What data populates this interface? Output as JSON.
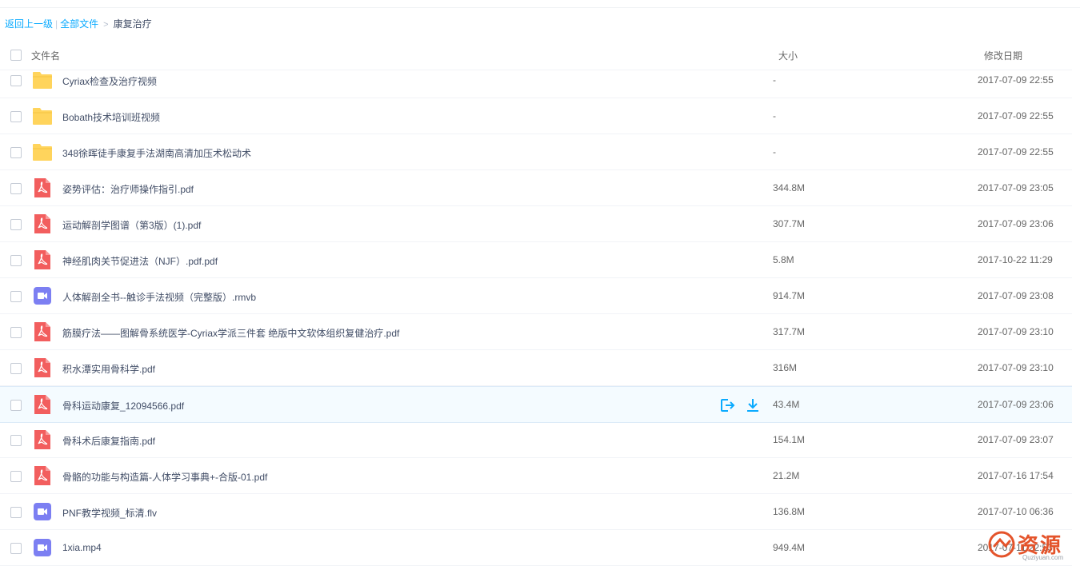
{
  "breadcrumb": {
    "back": "返回上一级",
    "separator": "|",
    "all_files": "全部文件",
    "arrow": ">",
    "current": "康复治疗"
  },
  "columns": {
    "name": "文件名",
    "size": "大小",
    "date": "修改日期"
  },
  "files": [
    {
      "type": "folder",
      "name": "Cyriax检查及治疗视频",
      "size": "-",
      "date": "2017-07-09 22:55"
    },
    {
      "type": "folder",
      "name": "Bobath技术培训班视频",
      "size": "-",
      "date": "2017-07-09 22:55"
    },
    {
      "type": "folder",
      "name": "348徐晖徒手康复手法湖南高清加压术松动术",
      "size": "-",
      "date": "2017-07-09 22:55"
    },
    {
      "type": "pdf",
      "name": "姿势评估：治疗师操作指引.pdf",
      "size": "344.8M",
      "date": "2017-07-09 23:05"
    },
    {
      "type": "pdf",
      "name": "运动解剖学图谱（第3版）(1).pdf",
      "size": "307.7M",
      "date": "2017-07-09 23:06"
    },
    {
      "type": "pdf",
      "name": "神经肌肉关节促进法（NJF）.pdf.pdf",
      "size": "5.8M",
      "date": "2017-10-22 11:29"
    },
    {
      "type": "video",
      "name": "人体解剖全书--触诊手法视频（完整版）.rmvb",
      "size": "914.7M",
      "date": "2017-07-09 23:08"
    },
    {
      "type": "pdf",
      "name": "筋膜疗法——图解骨系统医学-Cyriax学派三件套 绝版中文软体组织复健治疗.pdf",
      "size": "317.7M",
      "date": "2017-07-09 23:10"
    },
    {
      "type": "pdf",
      "name": "积水潭实用骨科学.pdf",
      "size": "316M",
      "date": "2017-07-09 23:10"
    },
    {
      "type": "pdf",
      "name": "骨科运动康复_12094566.pdf",
      "size": "43.4M",
      "date": "2017-07-09 23:06",
      "hover": true
    },
    {
      "type": "pdf",
      "name": "骨科术后康复指南.pdf",
      "size": "154.1M",
      "date": "2017-07-09 23:07"
    },
    {
      "type": "pdf",
      "name": "骨骼的功能与构造篇-人体学习事典+-合版-01.pdf",
      "size": "21.2M",
      "date": "2017-07-16 17:54"
    },
    {
      "type": "video",
      "name": "PNF教学视频_标清.flv",
      "size": "136.8M",
      "date": "2017-07-10 06:36"
    },
    {
      "type": "video",
      "name": "1xia.mp4",
      "size": "949.4M",
      "date": "2017-07-11 22:53"
    }
  ],
  "icons": {
    "folder": "folder-icon",
    "pdf": "pdf-icon",
    "video": "video-icon",
    "share": "share-icon",
    "download": "download-icon"
  },
  "colors": {
    "link": "#09aaff",
    "folder": "#ffd45c",
    "pdf": "#f25e5e",
    "video": "#7c7ff2",
    "action": "#09aaff"
  },
  "watermark": {
    "text": "资源",
    "sub": "Quziyuan.com"
  }
}
